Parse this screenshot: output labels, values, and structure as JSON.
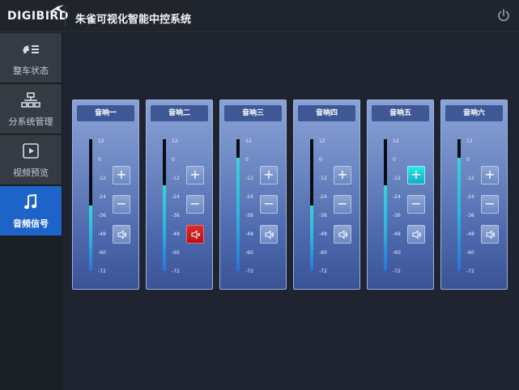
{
  "header": {
    "logo_text": "DIGIBIRD",
    "title": "朱雀可视化智能中控系统",
    "power_icon": "power-icon"
  },
  "sidebar": {
    "items": [
      {
        "label": "整车状态",
        "icon": "vehicle-status-icon",
        "active": false
      },
      {
        "label": "分系统管理",
        "icon": "subsystem-tree-icon",
        "active": false
      },
      {
        "label": "视频预览",
        "icon": "video-play-icon",
        "active": false
      },
      {
        "label": "音频信号",
        "icon": "music-note-icon",
        "active": true
      }
    ]
  },
  "scale_ticks": [
    "12",
    "0",
    "-12",
    "-24",
    "-36",
    "-48",
    "-60",
    "-72"
  ],
  "channels": [
    {
      "name": "音响一",
      "level_percent": 50,
      "plus_highlighted": false,
      "muted": false
    },
    {
      "name": "音响二",
      "level_percent": 65,
      "plus_highlighted": false,
      "muted": true
    },
    {
      "name": "音响三",
      "level_percent": 86,
      "plus_highlighted": false,
      "muted": false
    },
    {
      "name": "音响四",
      "level_percent": 50,
      "plus_highlighted": false,
      "muted": false
    },
    {
      "name": "音响五",
      "level_percent": 65,
      "plus_highlighted": true,
      "muted": false
    },
    {
      "name": "音响六",
      "level_percent": 86,
      "plus_highlighted": false,
      "muted": false
    }
  ],
  "buttons": {
    "plus": "+",
    "minus": "−"
  },
  "colors": {
    "accent": "#1e63c8",
    "mute_active": "#d11f1f",
    "highlight": "#22d3d6"
  }
}
